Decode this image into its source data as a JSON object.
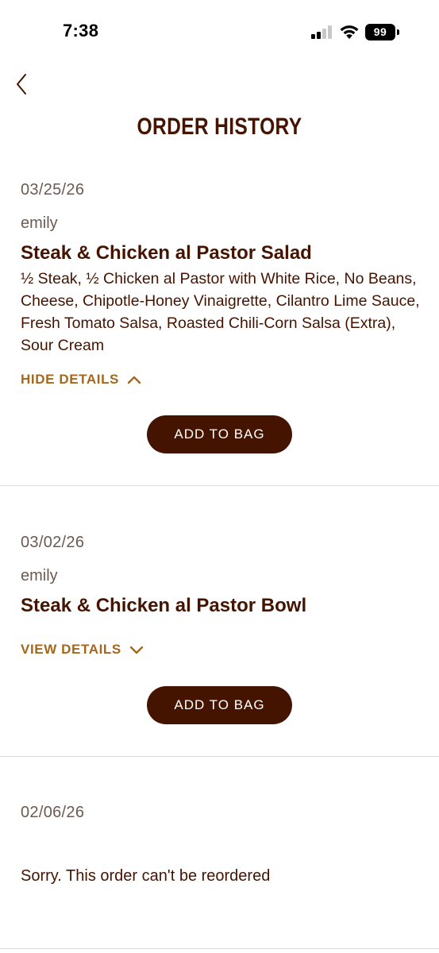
{
  "status_bar": {
    "time": "7:38",
    "battery": "99"
  },
  "header": {
    "title": "ORDER HISTORY"
  },
  "orders": [
    {
      "date": "03/25/26",
      "user": "emily",
      "title": "Steak & Chicken al Pastor Salad",
      "description": "½ Steak, ½ Chicken al Pastor with White Rice, No Beans, Cheese, Chipotle-Honey Vinaigrette, Cilantro Lime Sauce, Fresh Tomato Salsa, Roasted Chili-Corn Salsa (Extra), Sour Cream",
      "toggle_label": "HIDE DETAILS",
      "button_label": "ADD TO BAG"
    },
    {
      "date": "03/02/26",
      "user": "emily",
      "title": "Steak & Chicken al Pastor Bowl",
      "toggle_label": "VIEW DETAILS",
      "button_label": "ADD TO BAG"
    },
    {
      "date": "02/06/26",
      "note": "Sorry. This order can't be reordered"
    }
  ],
  "colors": {
    "brand_brown": "#451400",
    "accent_gold": "#a4671d",
    "muted_text": "#6b5a52",
    "divider": "#d9d9d9"
  },
  "icons": {
    "back": "chevron-left-icon",
    "collapse": "chevron-up-icon",
    "expand": "chevron-down-icon"
  }
}
